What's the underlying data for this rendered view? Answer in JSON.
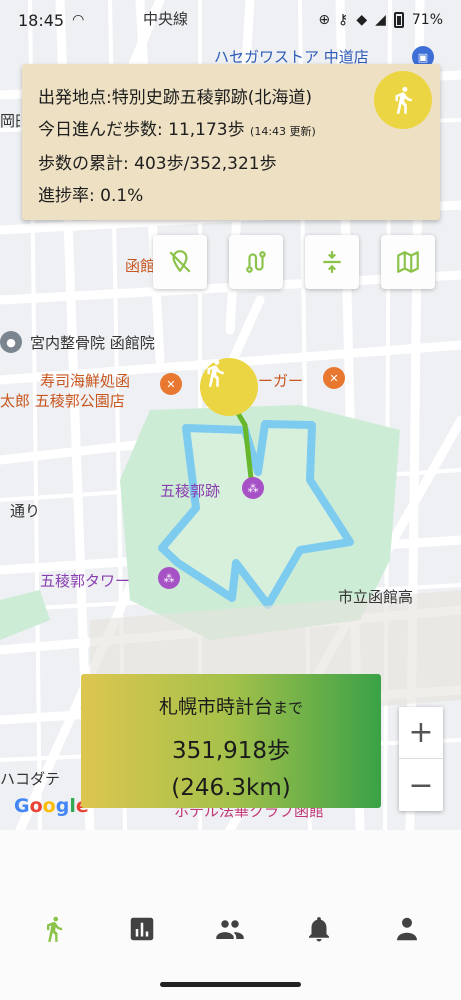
{
  "status": {
    "time": "18:45",
    "battery": "71%"
  },
  "map": {
    "labels": {
      "chuo_line": "中央線",
      "hasegawa": "ハセガワストア 中道店",
      "okada": "岡田",
      "hakodate_cut": "函館",
      "miyauchi": "宮内整骨院 函館院",
      "sushi": "寿司海鮮処函",
      "taro": "太郎 五稜郭公園店",
      "burger": "ーガー",
      "goryokaku": "五稜郭跡",
      "tower": "五稜郭タワー",
      "shiritsu": "市立函館高",
      "dori": "通り",
      "hakodate_mid": "ハコダテ",
      "hotel": "ホテル法華クラブ函館"
    }
  },
  "info_card": {
    "start": "出発地点:特別史跡五稜郭跡(北海道)",
    "today": "今日進んだ歩数: 11,173歩",
    "today_updated": "(14:43 更新)",
    "total": "歩数の累計: 403歩/352,321歩",
    "progress": "進捗率: 0.1%"
  },
  "toolbar": {
    "buttons": [
      "location-off-icon",
      "route-icon",
      "collapse-icon",
      "map-icon"
    ]
  },
  "destination": {
    "name": "札幌市時計台",
    "suffix": "まで",
    "steps": "351,918歩",
    "distance": "(246.3km)"
  },
  "zoom": {
    "in": "+",
    "out": "−"
  },
  "attribution": "Google",
  "nav": {
    "items": [
      "walk-icon",
      "chart-icon",
      "group-icon",
      "bell-icon",
      "person-icon"
    ],
    "active": "walk-icon",
    "colors": {
      "active": "#8bc34a",
      "inactive": "#424242"
    }
  },
  "colors": {
    "card_bg": "#ede0c3",
    "walker_bg": "#ecd542",
    "park_green": "#cdecd6",
    "route_blue": "#7ecbf0",
    "path_green": "#67b72c"
  }
}
